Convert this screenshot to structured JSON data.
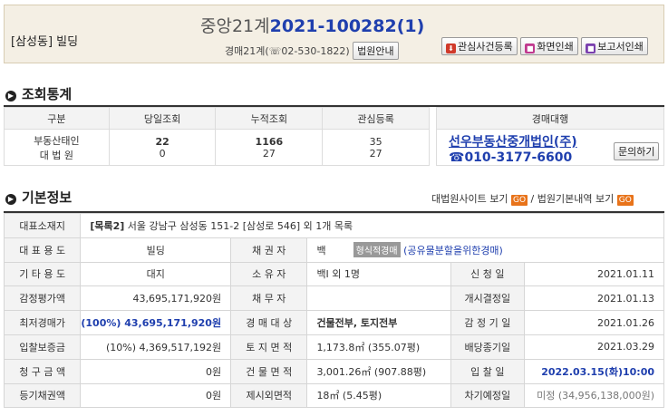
{
  "header": {
    "location": "[삼성동] 빌딩",
    "court_name": "중앙21계",
    "case_number": "2021-100282(1)",
    "court_sub": "경매21계(☏02-530-1822)",
    "court_info_btn": "법원안내",
    "buttons": {
      "interest": "관심사건등록",
      "print_screen": "화면인쇄",
      "print_report": "보고서인쇄"
    }
  },
  "stats": {
    "title": "조회통계",
    "headers": [
      "구분",
      "당일조회",
      "누적조회",
      "관심등록"
    ],
    "row_labels": [
      "부동산태인",
      "대 법 원"
    ],
    "today": [
      "22",
      "0"
    ],
    "total": [
      "1166",
      "27"
    ],
    "interest": [
      "35",
      "27"
    ],
    "agent_header": "경매대행",
    "agent_name": "선우부동산중개법인(주)",
    "agent_phone": "☎010-3177-6600",
    "inquiry_btn": "문의하기"
  },
  "basic": {
    "title": "기본정보",
    "link1": "대법원사이트 보기",
    "link2": "법원기본내역 보기",
    "go": "GO",
    "sep": "/",
    "address_label": "대표소재지",
    "address_tag": "[목록2]",
    "address": " 서울 강남구 삼성동 151-2 [삼성로 546] 외 1개 목록",
    "rows": [
      {
        "l1": "대 표 용 도",
        "v1": "빌딩",
        "l2": "채 권 자",
        "v2": "백",
        "badge": "형식적경매",
        "v2b": "(공유물분할을위한경매)"
      },
      {
        "l1": "기 타 용 도",
        "v1": "대지",
        "l2": "소 유 자",
        "v2": "백I    외 1명",
        "l3": "신 청 일",
        "v3": "2021.01.11"
      },
      {
        "l1": "감정평가액",
        "v1": "43,695,171,920원",
        "l2": "채 무 자",
        "v2": "",
        "l3": "개시결정일",
        "v3": "2021.01.13"
      },
      {
        "l1": "최저경매가",
        "v1": "(100%) 43,695,171,920원",
        "l2": "경 매 대 상",
        "v2": "건물전부, 토지전부",
        "l3": "감 정 기 일",
        "v3": "2021.01.26"
      },
      {
        "l1": "입찰보증금",
        "v1": "(10%) 4,369,517,192원",
        "l2": "토 지 면 적",
        "v2": "1,173.8㎡ (355.07평)",
        "l3": "배당종기일",
        "v3": "2021.03.29"
      },
      {
        "l1": "청 구 금 액",
        "v1": "0원",
        "l2": "건 물 면 적",
        "v2": "3,001.26㎡ (907.88평)",
        "l3": "입 찰 일",
        "v3": "2022.03.15(화)10:00"
      },
      {
        "l1": "등기채권액",
        "v1": "0원",
        "l2": "제시외면적",
        "v2": "18㎡ (5.45평)",
        "l3": "차기예정일",
        "v3": "미정 (34,956,138,000원)"
      }
    ]
  },
  "colors": {
    "accent": "#1f3fae",
    "go": "#e8731a",
    "header_bg": "#f4efe4",
    "label_bg": "#f3f3f3"
  }
}
